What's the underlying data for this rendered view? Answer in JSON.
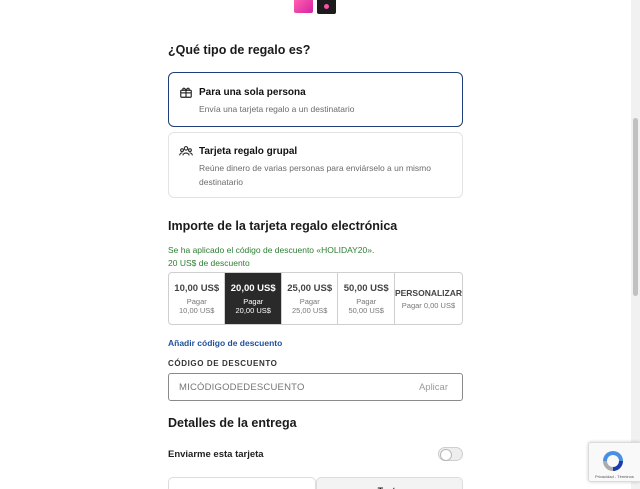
{
  "gift_type": {
    "heading": "¿Qué tipo de regalo es?",
    "options": [
      {
        "title": "Para una sola persona",
        "desc": "Envía una tarjeta regalo a un destinatario",
        "icon": "gift-icon",
        "selected": true
      },
      {
        "title": "Tarjeta regalo grupal",
        "desc": "Reúne dinero de varias personas para enviárselo a un mismo destinatario",
        "icon": "group-icon",
        "selected": false
      }
    ]
  },
  "amount": {
    "heading": "Importe de la tarjeta regalo electrónica",
    "discount_line1": "Se ha aplicado el código de descuento «HOLIDAY20».",
    "discount_line2": "20 US$ de descuento",
    "options": [
      {
        "value": "10,00 US$",
        "pay_label": "Pagar",
        "pay_amount": "10,00 US$",
        "selected": false
      },
      {
        "value": "20,00 US$",
        "pay_label": "Pagar",
        "pay_amount": "20,00 US$",
        "selected": true
      },
      {
        "value": "25,00 US$",
        "pay_label": "Pagar",
        "pay_amount": "25,00 US$",
        "selected": false
      },
      {
        "value": "50,00 US$",
        "pay_label": "Pagar",
        "pay_amount": "50,00 US$",
        "selected": false
      },
      {
        "value": "PERSONALIZAR",
        "pay_label": "Pagar 0,00 US$",
        "pay_amount": "",
        "selected": false
      }
    ],
    "add_code_link": "Añadir código de descuento",
    "code_label": "CÓDIGO DE DESCUENTO",
    "code_placeholder": "MICÓDIGODEDESCUENTO",
    "apply_label": "Aplicar"
  },
  "delivery": {
    "heading": "Detalles de la entrega",
    "send_to_me_label": "Enviarme esta tarjeta",
    "send_to_me_on": false,
    "tabs": [
      "",
      "Texto"
    ]
  },
  "recaptcha": {
    "legal": "Privacidad - Términos"
  },
  "colors": {
    "accent": "#1f3f7a",
    "success": "#2e7d32",
    "link": "#1f4f9a",
    "selected_amount_bg": "#2a2a2a"
  }
}
